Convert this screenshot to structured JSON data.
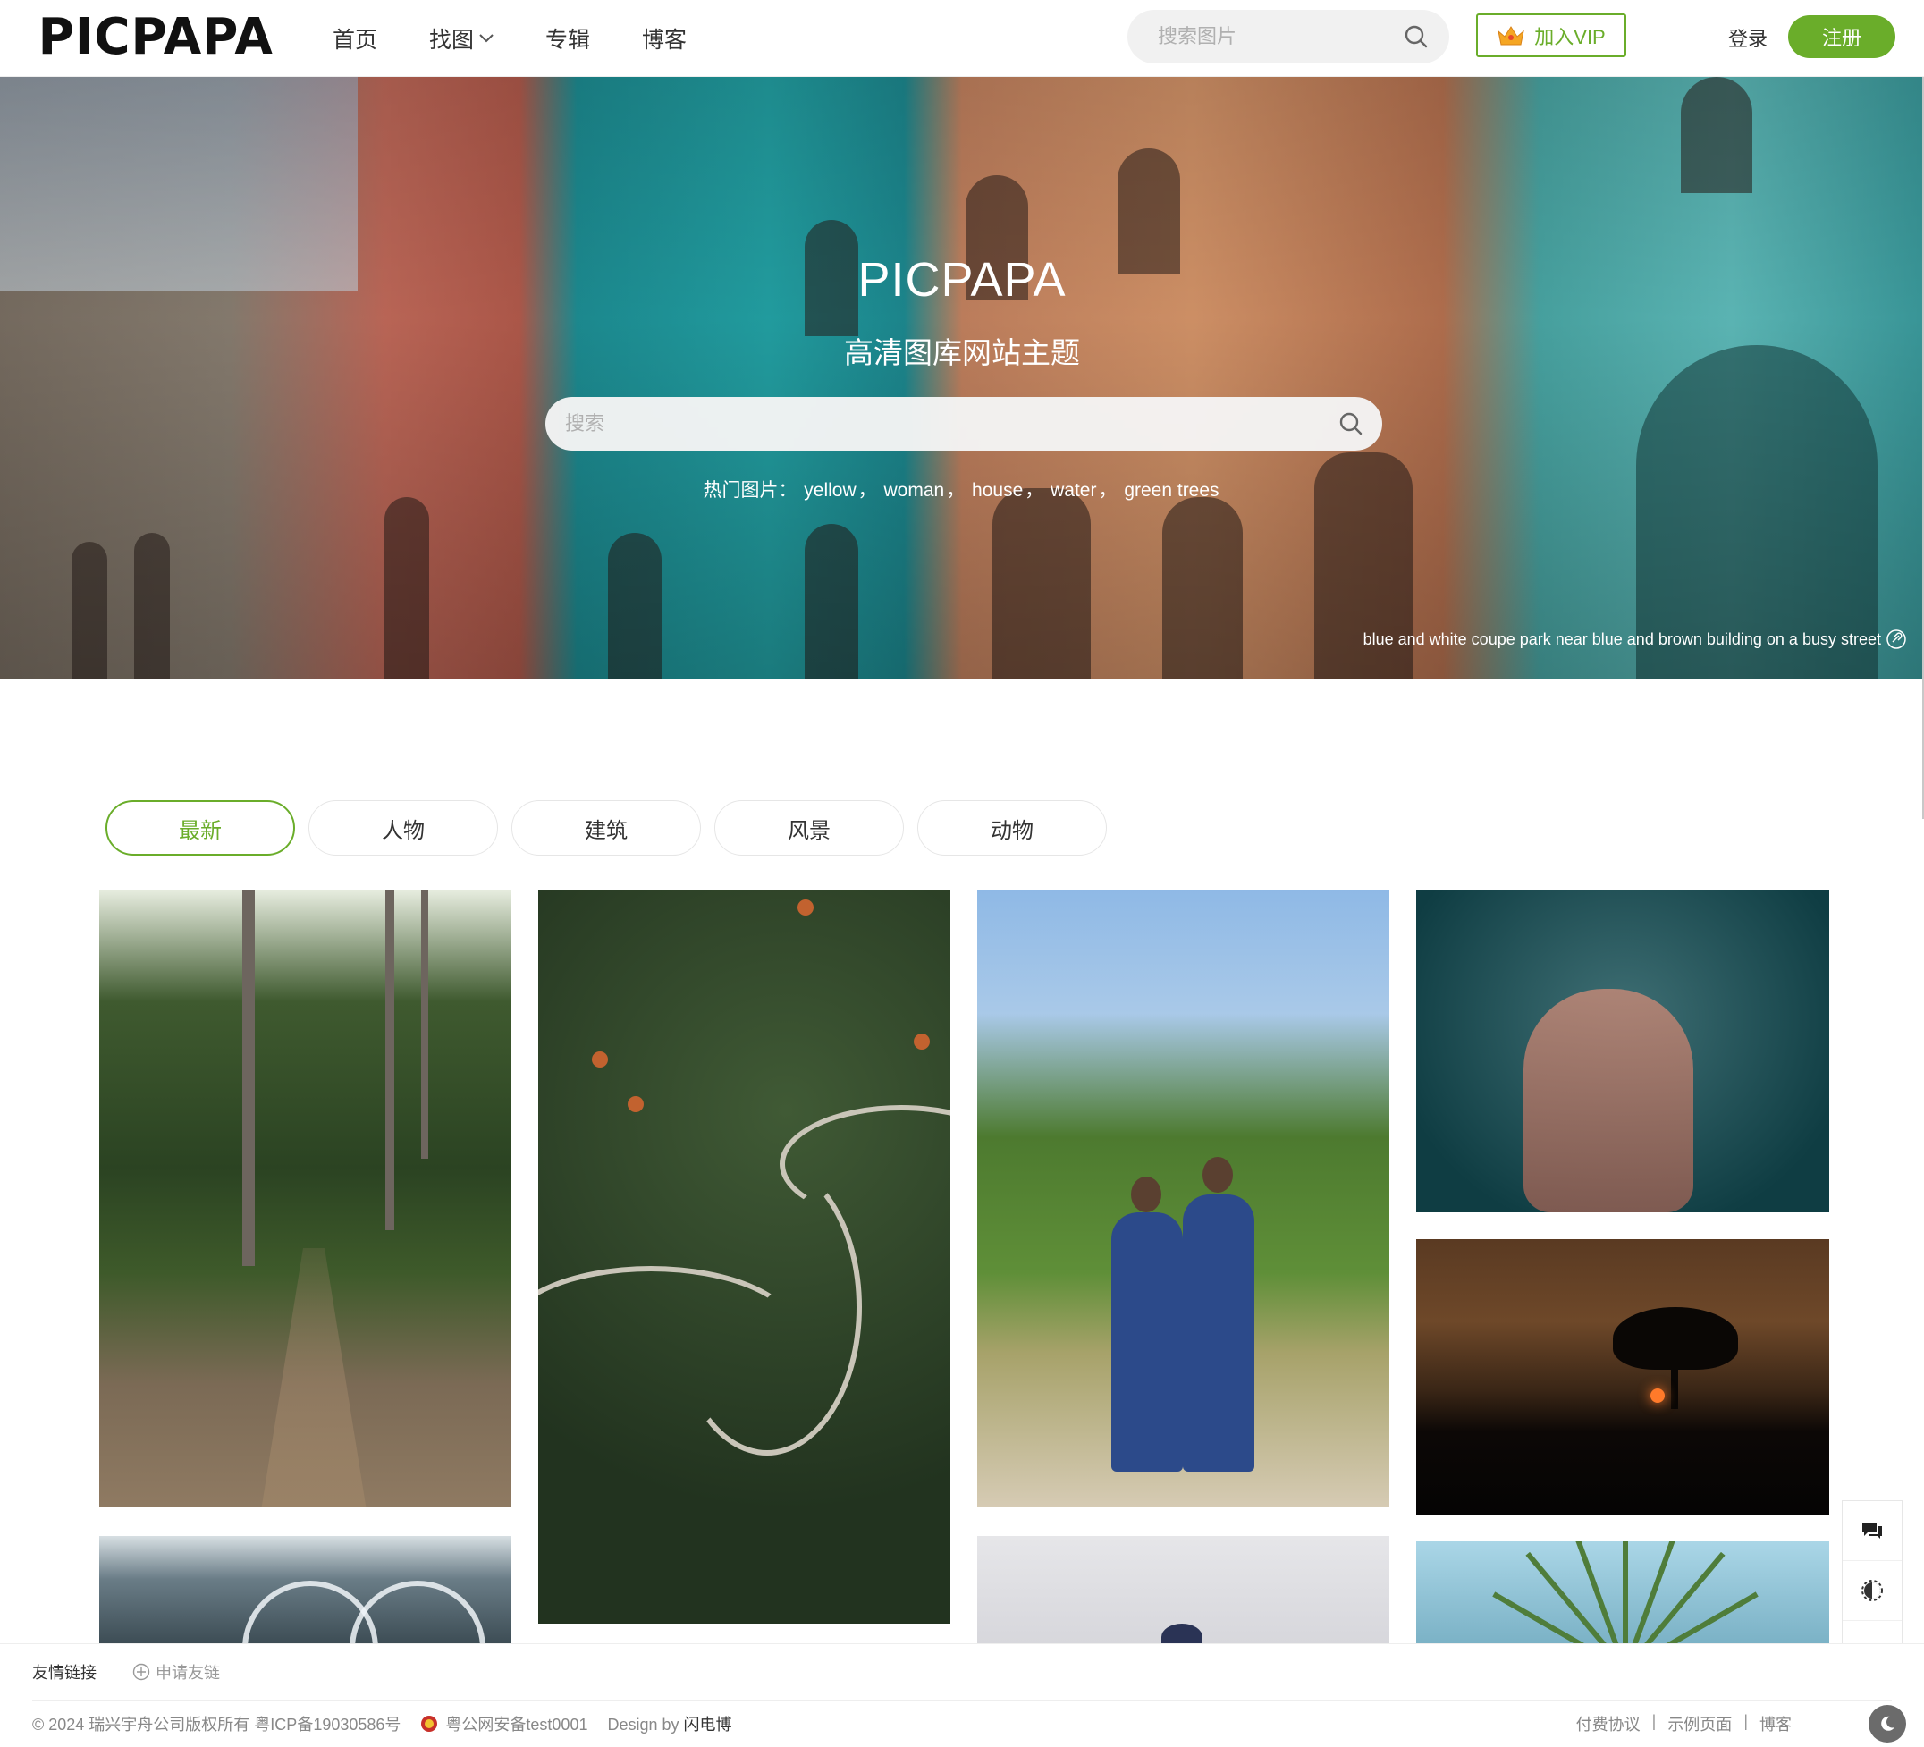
{
  "brand": {
    "logo_text": "PICPAPA"
  },
  "nav": {
    "items": [
      {
        "label": "首页"
      },
      {
        "label": "找图",
        "has_dropdown": true
      },
      {
        "label": "专辑"
      },
      {
        "label": "博客"
      }
    ]
  },
  "header": {
    "search_placeholder": "搜索图片",
    "vip_label": "加入VIP",
    "login_label": "登录",
    "register_label": "注册"
  },
  "hero": {
    "title": "PICPAPA",
    "subtitle": "高清图库网站主题",
    "search_placeholder": "搜索",
    "hot_label": "热门图片：",
    "hot_tags": [
      "yellow",
      "woman",
      "house",
      "water",
      "green trees"
    ],
    "caption": "blue and white coupe park near blue and brown building on a busy street"
  },
  "tabs": [
    {
      "label": "最新",
      "active": true
    },
    {
      "label": "人物",
      "active": false
    },
    {
      "label": "建筑",
      "active": false
    },
    {
      "label": "风景",
      "active": false
    },
    {
      "label": "动物",
      "active": false
    }
  ],
  "footer": {
    "friend_links_title": "友情链接",
    "apply_link_label": "申请友链",
    "copyright": "© 2024 瑞兴宇舟公司版权所有 粤ICP备19030586号",
    "police_record": "粤公网安备test0001",
    "design_prefix": "Design by",
    "design_name": "闪电博",
    "links": [
      "付费协议",
      "示例页面",
      "博客"
    ]
  },
  "colors": {
    "accent": "#6aad2a",
    "text": "#333333",
    "muted": "#888888"
  }
}
